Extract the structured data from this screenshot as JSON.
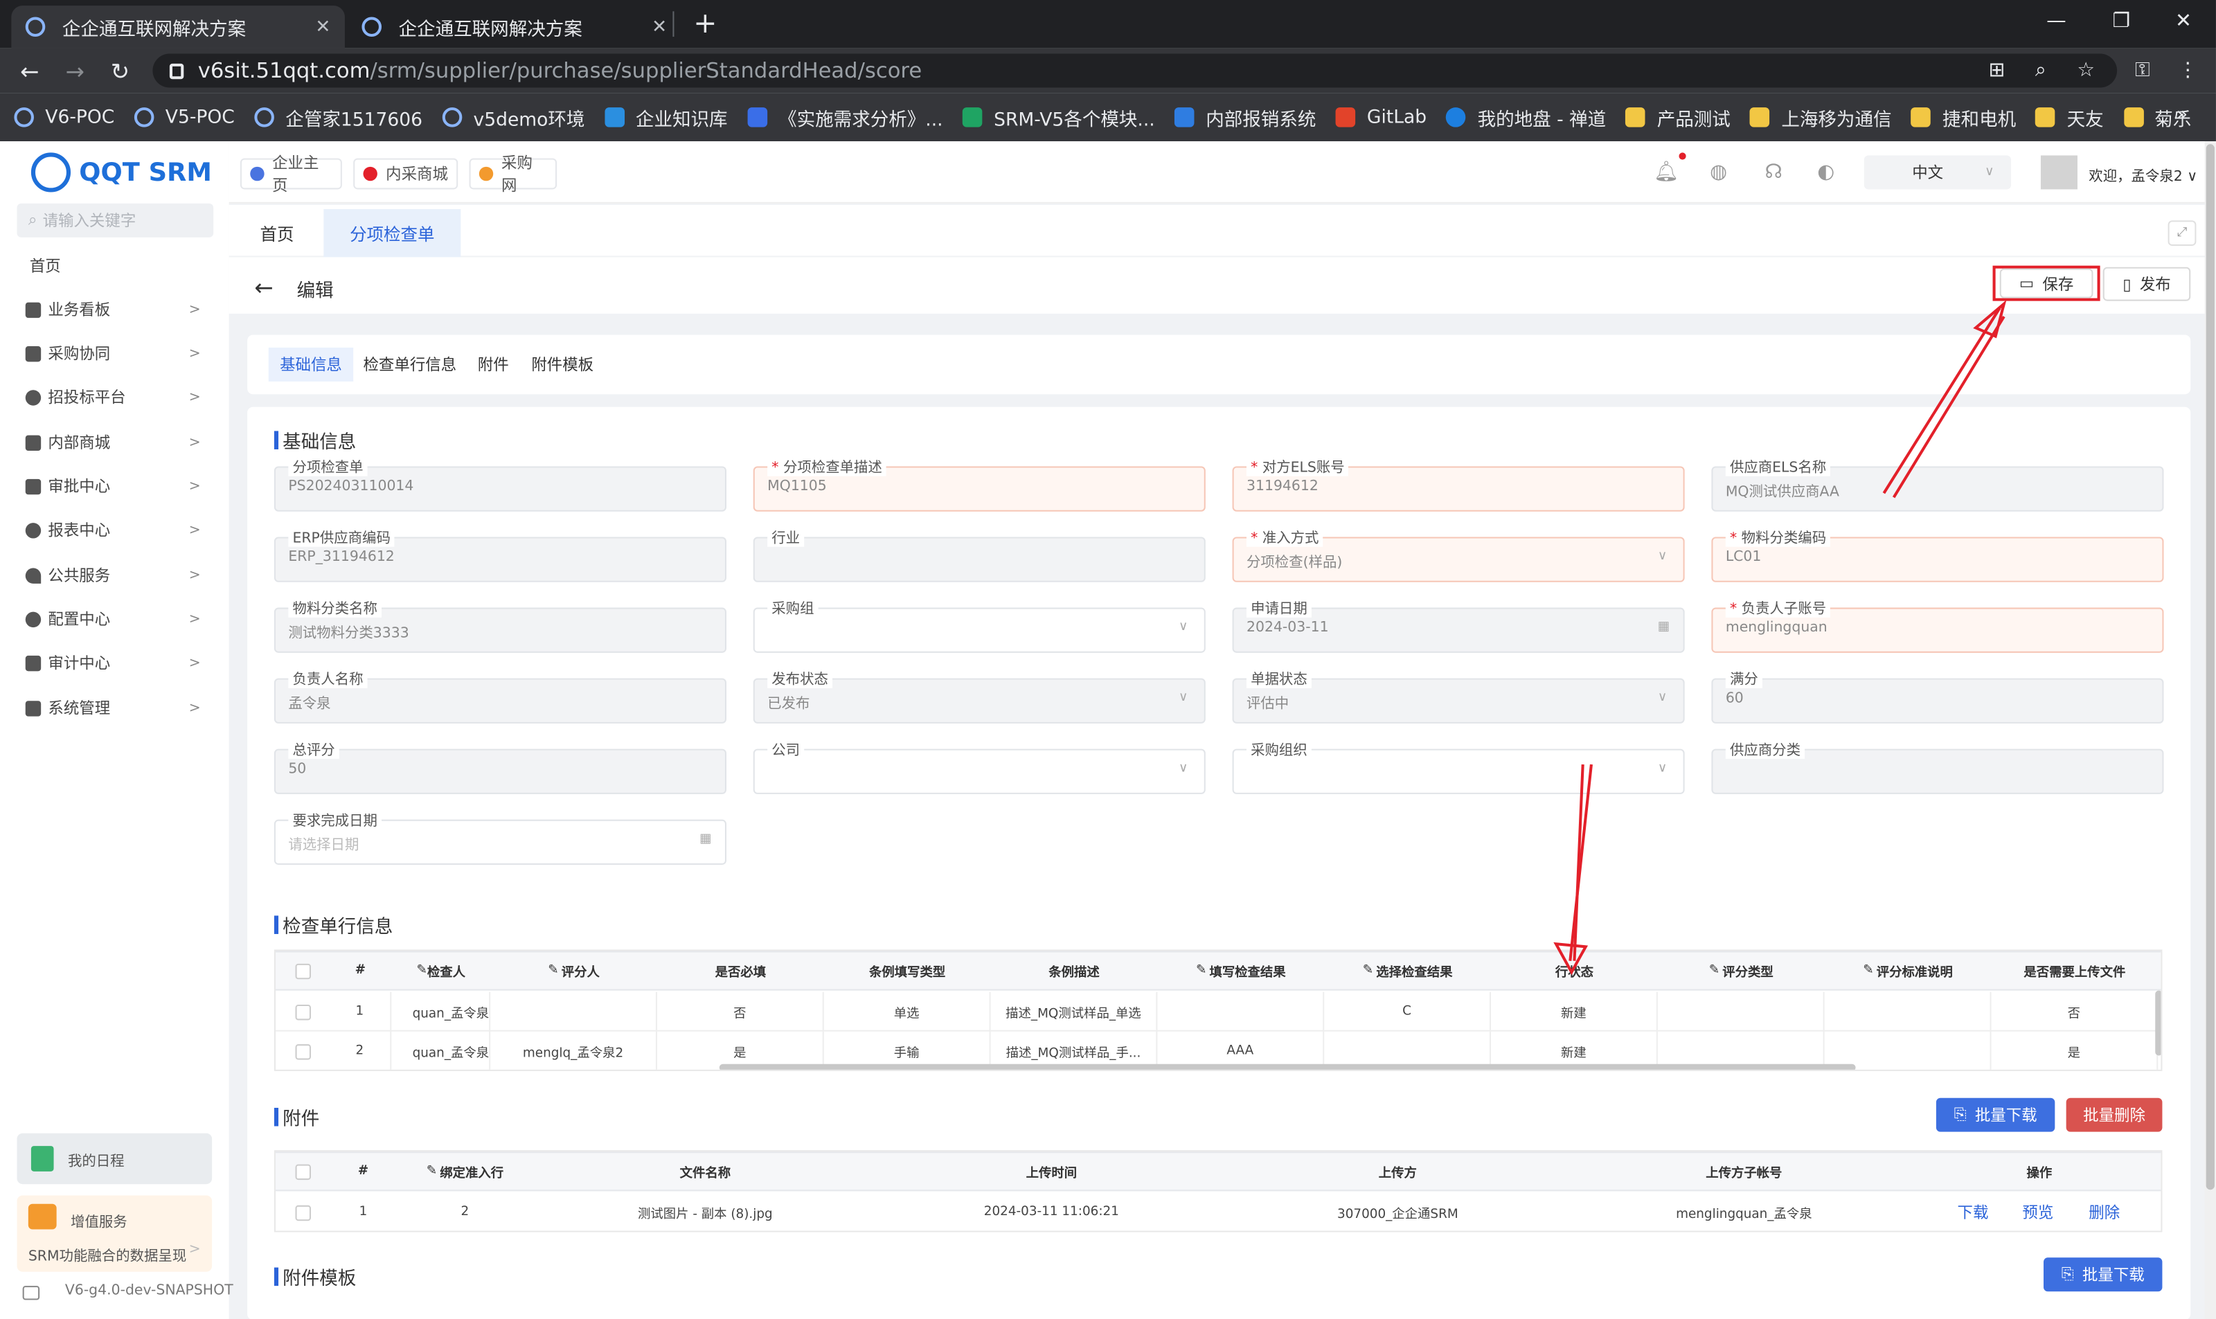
{
  "browser": {
    "tabs": [
      {
        "title": "企企通互联网解决方案"
      },
      {
        "title": "企企通互联网解决方案"
      }
    ],
    "url_host": "v6sit.51qqt.com",
    "url_path": "/srm/supplier/purchase/supplierStandardHead/score",
    "bookmarks": [
      "V6-POC",
      "V5-POC",
      "企管家1517606",
      "v5demo环境",
      "企业知识库",
      "《实施需求分析》...",
      "SRM-V5各个模块...",
      "内部报销系统",
      "GitLab",
      "我的地盘 - 禅道",
      "产品测试",
      "上海移为通信",
      "捷和电机",
      "天友",
      "菊乐"
    ],
    "more": "»"
  },
  "sidebar": {
    "logo": "QQT SRM",
    "search_placeholder": "请输入关键字",
    "home": "首页",
    "items": [
      "业务看板",
      "采购协同",
      "招投标平台",
      "内部商城",
      "审批中心",
      "报表中心",
      "公共服务",
      "配置中心",
      "审计中心",
      "系统管理"
    ],
    "schedule": "我的日程",
    "vas_title": "增值服务",
    "vas_sub": "SRM功能融合的数据呈现",
    "version": "V6-g4.0-dev-SNAPSHOT"
  },
  "topnav": {
    "links": [
      "企业主页",
      "内采商城",
      "采购网"
    ],
    "lang": "中文",
    "welcome": "欢迎，孟令泉2"
  },
  "pagetabs": [
    "首页",
    "分项检查单"
  ],
  "header": {
    "title": "编辑",
    "save": "保存",
    "publish": "发布"
  },
  "section_tabs": [
    "基础信息",
    "检查单行信息",
    "附件",
    "附件模板"
  ],
  "basic": {
    "title": "基础信息",
    "fields": [
      {
        "label": "分项检查单",
        "value": "PS202403110014",
        "req": false
      },
      {
        "label": "分项检查单描述",
        "value": "MQ1105",
        "req": true
      },
      {
        "label": "对方ELS账号",
        "value": "31194612",
        "req": true
      },
      {
        "label": "供应商ELS名称",
        "value": "MQ测试供应商AA",
        "req": false
      },
      {
        "label": "ERP供应商编码",
        "value": "ERP_31194612",
        "req": false
      },
      {
        "label": "行业",
        "value": "",
        "req": false
      },
      {
        "label": "准入方式",
        "value": "分项检查(样品)",
        "req": true
      },
      {
        "label": "物料分类编码",
        "value": "LC01",
        "req": true
      },
      {
        "label": "物料分类名称",
        "value": "测试物料分类3333",
        "req": false
      },
      {
        "label": "采购组",
        "value": "",
        "req": false
      },
      {
        "label": "申请日期",
        "value": "2024-03-11",
        "req": false
      },
      {
        "label": "负责人子账号",
        "value": "menglingquan",
        "req": true
      },
      {
        "label": "负责人名称",
        "value": "孟令泉",
        "req": false
      },
      {
        "label": "发布状态",
        "value": "已发布",
        "req": false
      },
      {
        "label": "单据状态",
        "value": "评估中",
        "req": false
      },
      {
        "label": "满分",
        "value": "60",
        "req": false
      },
      {
        "label": "总评分",
        "value": "50",
        "req": false
      },
      {
        "label": "公司",
        "value": "",
        "req": false
      },
      {
        "label": "采购组织",
        "value": "",
        "req": false
      },
      {
        "label": "供应商分类",
        "value": "",
        "req": false
      },
      {
        "label": "要求完成日期",
        "value": "",
        "placeholder": "请选择日期",
        "req": false
      }
    ]
  },
  "lines": {
    "title": "检查单行信息",
    "columns": [
      "#",
      "检查人",
      "评分人",
      "是否必填",
      "条例填写类型",
      "条例描述",
      "填写检查结果",
      "选择检查结果",
      "行状态",
      "评分类型",
      "评分标准说明",
      "是否需要上传文件"
    ],
    "rows": [
      [
        "1",
        "quan_孟令泉",
        "",
        "否",
        "单选",
        "描述_MQ测试样品_单选",
        "",
        "C",
        "新建",
        "",
        "",
        "否"
      ],
      [
        "2",
        "quan_孟令泉",
        "menglq_孟令泉2",
        "是",
        "手输",
        "描述_MQ测试样品_手...",
        "AAA",
        "",
        "新建",
        "",
        "",
        "是"
      ]
    ]
  },
  "attach": {
    "title": "附件",
    "batch_download": "批量下载",
    "batch_delete": "批量删除",
    "columns": [
      "#",
      "绑定准入行",
      "文件名称",
      "上传时间",
      "上传方",
      "上传方子帐号",
      "操作"
    ],
    "rows": [
      [
        "1",
        "2",
        "测试图片 - 副本 (8).jpg",
        "2024-03-11 11:06:21",
        "307000_企企通SRM",
        "menglingquan_孟令泉"
      ]
    ],
    "ops": [
      "下载",
      "预览",
      "删除"
    ]
  },
  "template": {
    "title": "附件模板",
    "batch_download": "批量下载"
  },
  "colors": {
    "accent": "#2b63d9",
    "danger": "#d9534f",
    "highlight": "#e3202a"
  }
}
